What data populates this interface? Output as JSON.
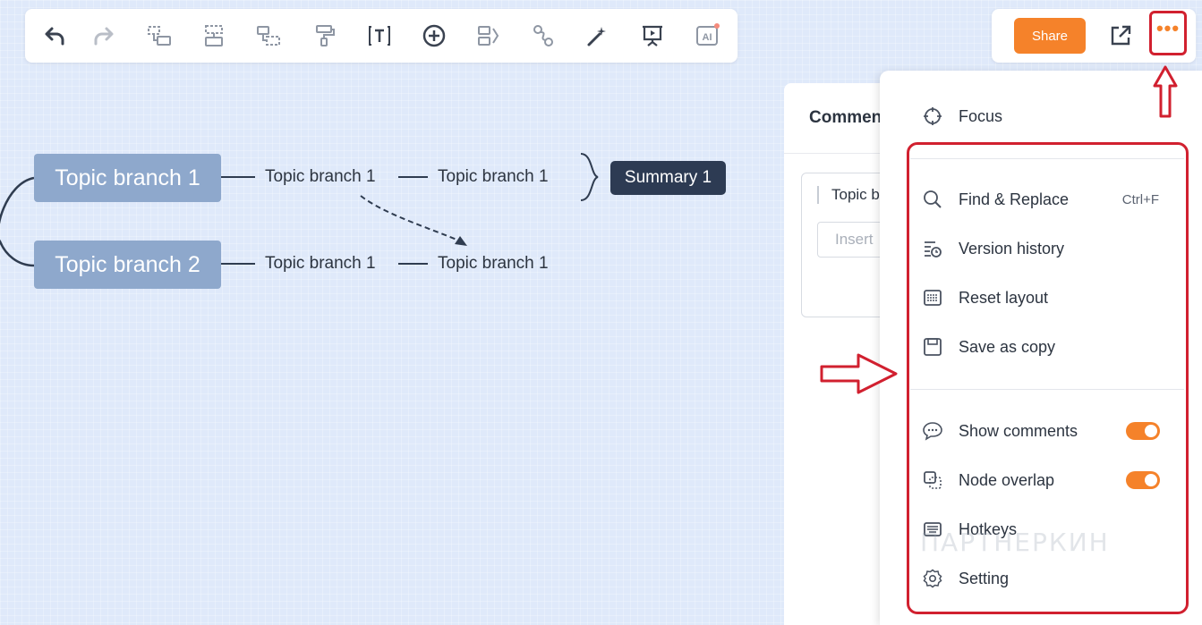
{
  "toolbar": {
    "items": [
      "undo-icon",
      "redo-icon",
      "subtopic-icon",
      "sibling-topic-icon",
      "parent-topic-icon",
      "format-painter-icon",
      "text-icon",
      "add-icon",
      "summary-icon",
      "relationship-icon",
      "magic-icon",
      "presentation-icon",
      "ai-icon"
    ],
    "ai_label": "AI"
  },
  "header": {
    "share_label": "Share",
    "more_label": "•••"
  },
  "mindmap": {
    "topic1": "Topic branch 1",
    "topic2": "Topic branch 2",
    "sub1a": "Topic branch 1",
    "sub1b": "Topic branch 1",
    "sub2a": "Topic branch 1",
    "sub2b": "Topic branch 1",
    "summary": "Summary 1"
  },
  "comments": {
    "title": "Commen",
    "topic": "Topic b",
    "input_placeholder": "Insert"
  },
  "menu": {
    "focus": "Focus",
    "find_replace": "Find & Replace",
    "find_shortcut": "Ctrl+F",
    "version_history": "Version history",
    "reset_layout": "Reset layout",
    "save_copy": "Save as copy",
    "show_comments": "Show comments",
    "show_comments_on": true,
    "node_overlap": "Node overlap",
    "node_overlap_on": true,
    "hotkeys": "Hotkeys",
    "setting": "Setting"
  },
  "watermark": "ПАРТНЕРКИН",
  "colors": {
    "accent": "#f5822a",
    "highlight": "#d1202f",
    "topic": "#8ea8cc",
    "summary": "#2d3b53"
  }
}
